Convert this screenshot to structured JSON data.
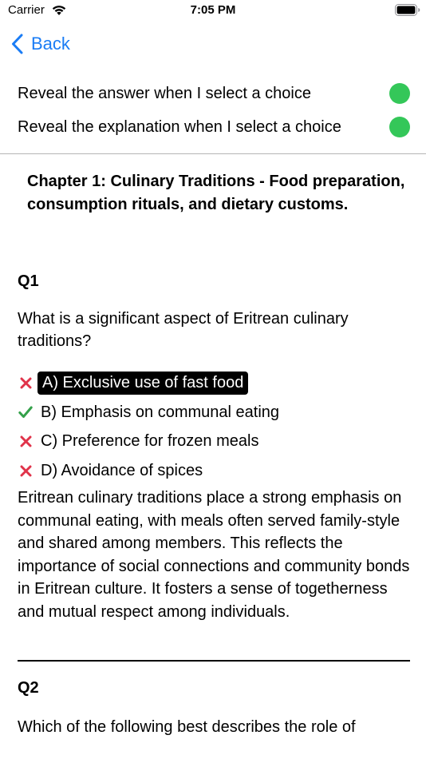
{
  "status_bar": {
    "carrier": "Carrier",
    "time": "7:05 PM",
    "icons": [
      "wifi-icon",
      "battery-icon"
    ]
  },
  "nav": {
    "back_label": "Back",
    "icon": "chevron-left-icon",
    "accent_color": "#1a7cf5"
  },
  "settings": {
    "toggle_color": "#34c759",
    "reveal_answer_label": "Reveal the answer when I select a choice",
    "reveal_explanation_label": "Reveal the explanation when I select a choice"
  },
  "chapter": {
    "title": "Chapter 1: Culinary Traditions - Food preparation, consumption rituals, and dietary customs."
  },
  "questions": [
    {
      "number": "Q1",
      "text": "What is a significant aspect of Eritrean culinary traditions?",
      "choices": [
        {
          "label": "A) Exclusive use of fast food",
          "mark": "cross-icon",
          "selected": true
        },
        {
          "label": "B) Emphasis on communal eating",
          "mark": "check-icon",
          "selected": false
        },
        {
          "label": "C) Preference for frozen meals",
          "mark": "cross-icon",
          "selected": false
        },
        {
          "label": "D) Avoidance of spices",
          "mark": "cross-icon",
          "selected": false
        }
      ],
      "explanation": "Eritrean culinary traditions place a strong emphasis on communal eating, with meals often served family-style and shared among members. This reflects the importance of social connections and community bonds in Eritrean culture. It fosters a sense of togetherness and mutual respect among individuals."
    },
    {
      "number": "Q2",
      "text": "Which of the following best describes the role of"
    }
  ],
  "colors": {
    "correct": "#34a14a",
    "incorrect": "#e0334a"
  }
}
